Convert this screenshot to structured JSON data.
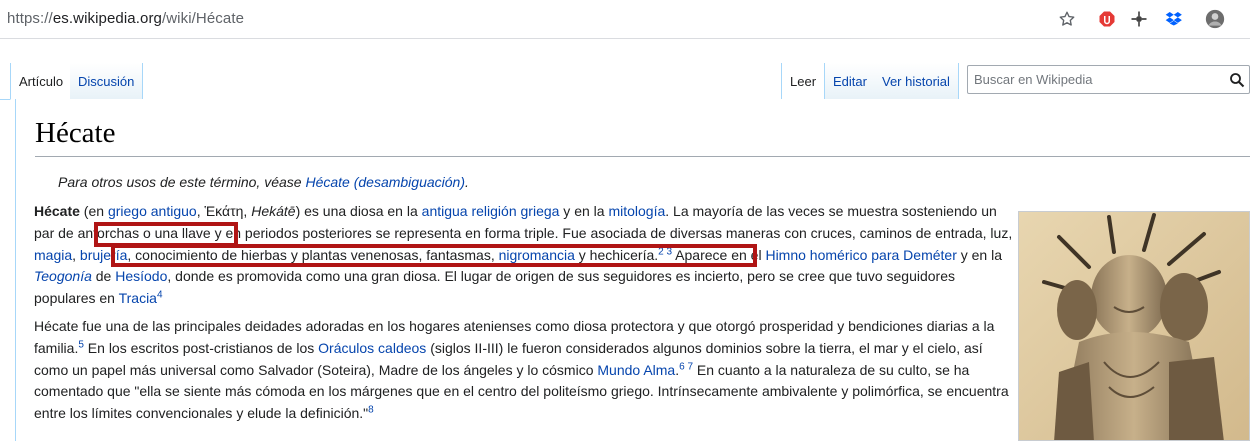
{
  "browser": {
    "url_prefix": "https://",
    "url_host": "es.wikipedia.org",
    "url_path": "/wiki/Hécate"
  },
  "tabs": {
    "articulo": "Artículo",
    "discusion": "Discusión",
    "leer": "Leer",
    "editar": "Editar",
    "ver_historial": "Ver historial"
  },
  "search": {
    "placeholder": "Buscar en Wikipedia"
  },
  "article": {
    "title": "Hécate",
    "hatnote": {
      "prefix": "Para otros usos de este término, véase ",
      "link": "Hécate (desambiguación)",
      "suffix": "."
    },
    "p1": {
      "bold": "Hécate",
      "t1": " (en ",
      "l1": "griego antiguo",
      "t2": ", Ἑκάτη, ",
      "i1": "Hekátē",
      "t3": ") es una diosa en la ",
      "l2": "antigua religión griega",
      "t4": " y en la ",
      "l3": "mitología",
      "t5": ". La mayoría de las veces se muestra sosteniendo un par de ",
      "hl1": "antorchas o una llave",
      "t6": "  y en periodos posteriores se representa en forma triple. Fue asociada de diversas maneras con cruces, caminos de entrada, luz, ",
      "l4": "magia",
      "t7": ", ",
      "l5": "brujería",
      "t8": ", conocimiento de hierbas y plantas venenosas, fantasmas, ",
      "l6": "nigromancia",
      "t9": " y hechicería.",
      "s1": "2",
      "s2": "3",
      "t10": " Aparece en el ",
      "l7": "Himno homérico para Deméter",
      "t11": " y en la ",
      "l8": "Teogonía",
      "t12": " de ",
      "l9": "Hesíodo",
      "t13": ", donde es promovida como una gran diosa. El lugar de origen de sus seguidores es incierto, pero se cree que tuvo seguidores populares en ",
      "l10": "Tracia",
      "s3": "4"
    },
    "p2": {
      "t1": "Hécate fue una de las principales deidades adoradas en los hogares atenienses como diosa protectora y que otorgó prosperidad y bendiciones diarias a la familia.",
      "s1": "5",
      "t2": "  En los escritos post-cristianos de los ",
      "l1": "Oráculos caldeos",
      "t3": " (siglos II-III) le fueron considerados algunos dominios sobre la tierra, el mar y el cielo, así como un papel más universal como Salvador (Soteira), Madre de los ángeles y lo cósmico ",
      "l2": "Mundo Alma",
      "t4": ".",
      "s2": "6",
      "s3": "7",
      "t5": "  En cuanto a la naturaleza de su culto, se ha comentado que \"ella se siente más cómoda en los márgenes que en el centro del politeísmo griego. Intrínsecamente ambivalente y polimórfica, se encuentra entre los límites convencionales y elude la definición.\"",
      "s4": "8"
    }
  },
  "colors": {
    "link": "#0645ad",
    "highlight": "#b01515",
    "tab_border": "#a7d7f9"
  },
  "icons": [
    "star-icon",
    "adblock-icon",
    "extension-icon",
    "dropbox-icon",
    "avatar",
    "search-icon"
  ]
}
